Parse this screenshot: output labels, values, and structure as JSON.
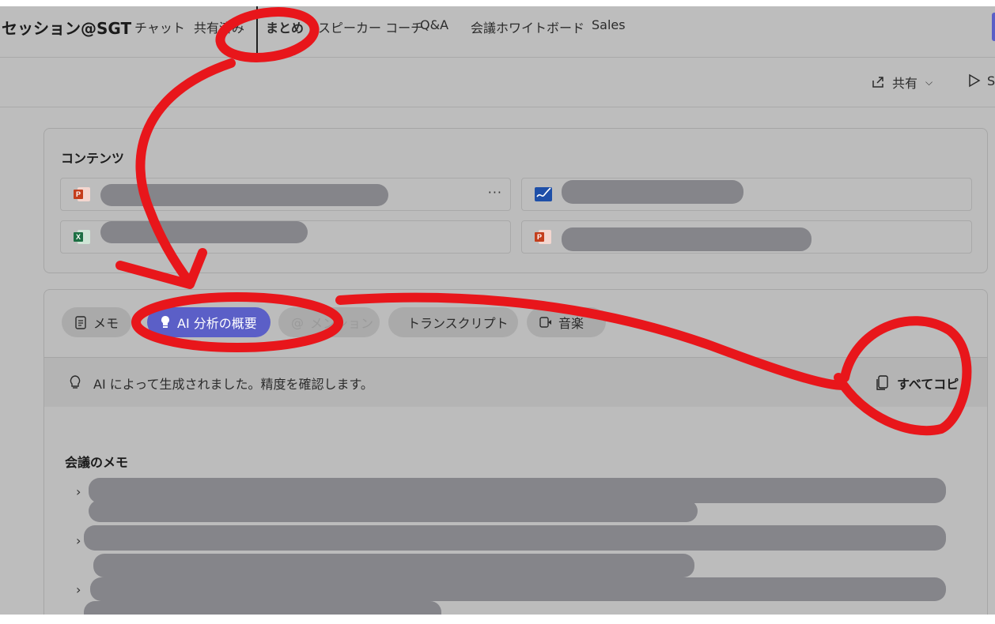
{
  "header": {
    "meeting_title": "セッション@SGT",
    "tabs": [
      {
        "label": "チャット"
      },
      {
        "label": "共有済み"
      },
      {
        "label": "まとめ"
      },
      {
        "label": "スピーカー コーチ"
      },
      {
        "label": "Q&A"
      },
      {
        "label": "会議ホワイトボード"
      },
      {
        "label": "Sales"
      }
    ]
  },
  "toolbar": {
    "share_label": "共有",
    "play_label": "S"
  },
  "content": {
    "section_title": "コンテンツ"
  },
  "recap": {
    "tabs": [
      {
        "label": "メモ"
      },
      {
        "label": "AI 分析の概要"
      },
      {
        "label": "メンション"
      },
      {
        "label": "トランスクリプト"
      },
      {
        "label": "音楽"
      }
    ],
    "ai_notice": "AI によって生成されました。精度を確認します。",
    "copy_all_label": "すべてコピ",
    "notes_title": "会議のメモ"
  },
  "colors": {
    "accent": "#5b5fc7",
    "annotation": "#e8161b",
    "redaction": "#85858a"
  }
}
